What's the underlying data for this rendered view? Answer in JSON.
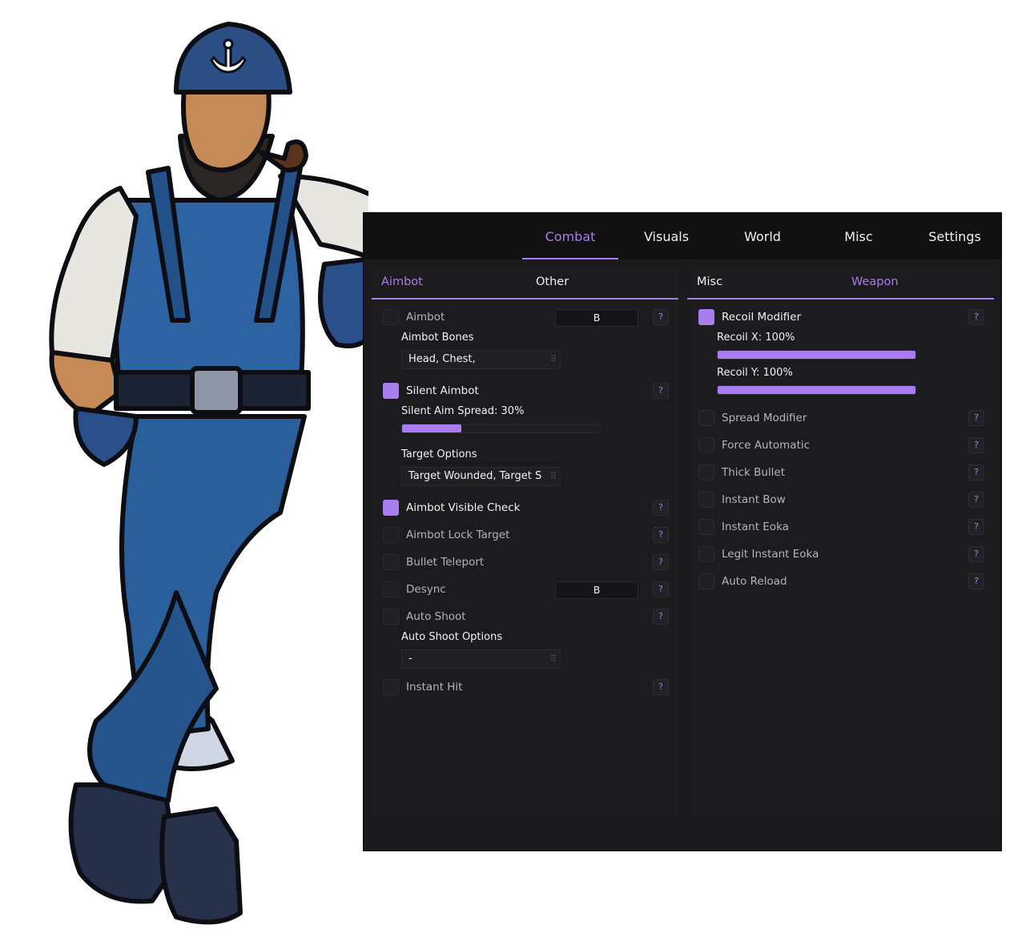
{
  "colors": {
    "accent": "#a97cf0",
    "panel_bg": "#1a1a1c",
    "topbar_bg": "#111112",
    "text": "#f0f0f0",
    "muted_text": "#b5b5b8"
  },
  "top_tabs": [
    {
      "label": "Combat",
      "active": true
    },
    {
      "label": "Visuals",
      "active": false
    },
    {
      "label": "World",
      "active": false
    },
    {
      "label": "Misc",
      "active": false
    },
    {
      "label": "Settings",
      "active": false
    }
  ],
  "left_panel": {
    "tabs": [
      {
        "label": "Aimbot",
        "active": true
      },
      {
        "label": "Other",
        "active": false
      }
    ],
    "aimbot": {
      "label": "Aimbot",
      "checked": false,
      "keybind": "B",
      "help": "?"
    },
    "aimbot_bones": {
      "label": "Aimbot Bones",
      "value": "Head, Chest,"
    },
    "silent_aimbot": {
      "label": "Silent Aimbot",
      "checked": true,
      "help": "?"
    },
    "silent_aim_spread": {
      "label": "Silent Aim Spread: 30%",
      "value": 0.3
    },
    "target_options": {
      "label": "Target Options",
      "value": "Target Wounded, Target Sc"
    },
    "aimbot_visible_check": {
      "label": "Aimbot Visible Check",
      "checked": true,
      "help": "?"
    },
    "aimbot_lock_target": {
      "label": "Aimbot Lock Target",
      "checked": false,
      "help": "?"
    },
    "bullet_teleport": {
      "label": "Bullet Teleport",
      "checked": false,
      "help": "?"
    },
    "desync": {
      "label": "Desync",
      "checked": false,
      "keybind": "B",
      "help": "?"
    },
    "auto_shoot": {
      "label": "Auto Shoot",
      "checked": false,
      "help": "?"
    },
    "auto_shoot_options": {
      "label": "Auto Shoot Options",
      "value": "-"
    },
    "instant_hit": {
      "label": "Instant Hit",
      "checked": false,
      "help": "?"
    }
  },
  "right_panel": {
    "tabs": [
      {
        "label": "Misc",
        "active": false
      },
      {
        "label": "Weapon",
        "active": true
      }
    ],
    "recoil_modifier": {
      "label": "Recoil Modifier",
      "checked": true,
      "help": "?"
    },
    "recoil_x": {
      "label": "Recoil X: 100%",
      "value": 1.0
    },
    "recoil_y": {
      "label": "Recoil Y: 100%",
      "value": 1.0
    },
    "spread_modifier": {
      "label": "Spread Modifier",
      "checked": false,
      "help": "?"
    },
    "force_automatic": {
      "label": "Force Automatic",
      "checked": false,
      "help": "?"
    },
    "thick_bullet": {
      "label": "Thick Bullet",
      "checked": false,
      "help": "?"
    },
    "instant_bow": {
      "label": "Instant Bow",
      "checked": false,
      "help": "?"
    },
    "instant_eoka": {
      "label": "Instant Eoka",
      "checked": false,
      "help": "?"
    },
    "legit_instant_eoka": {
      "label": "Legit Instant Eoka",
      "checked": false,
      "help": "?"
    },
    "auto_reload": {
      "label": "Auto Reload",
      "checked": false,
      "help": "?"
    }
  }
}
